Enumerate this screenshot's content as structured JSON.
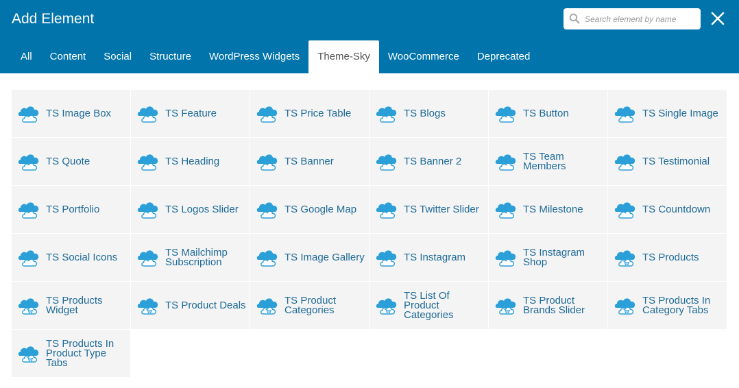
{
  "header": {
    "title": "Add Element",
    "search_placeholder": "Search element by name",
    "search_value": "",
    "background": "#0074ab"
  },
  "tabs": [
    {
      "label": "All",
      "active": false
    },
    {
      "label": "Content",
      "active": false
    },
    {
      "label": "Social",
      "active": false
    },
    {
      "label": "Structure",
      "active": false
    },
    {
      "label": "WordPress Widgets",
      "active": false
    },
    {
      "label": "Theme-Sky",
      "active": true
    },
    {
      "label": "WooCommerce",
      "active": false
    },
    {
      "label": "Deprecated",
      "active": false
    }
  ],
  "elements": [
    {
      "label": "TS Image Box",
      "icon": "cloud-icon"
    },
    {
      "label": "TS Feature",
      "icon": "cloud-icon"
    },
    {
      "label": "TS Price Table",
      "icon": "cloud-icon"
    },
    {
      "label": "TS Blogs",
      "icon": "cloud-icon"
    },
    {
      "label": "TS Button",
      "icon": "cloud-icon"
    },
    {
      "label": "TS Single Image",
      "icon": "cloud-icon"
    },
    {
      "label": "TS Quote",
      "icon": "cloud-icon"
    },
    {
      "label": "TS Heading",
      "icon": "cloud-icon"
    },
    {
      "label": "TS Banner",
      "icon": "cloud-icon"
    },
    {
      "label": "TS Banner 2",
      "icon": "cloud-icon"
    },
    {
      "label": "TS Team Members",
      "icon": "cloud-icon"
    },
    {
      "label": "TS Testimonial",
      "icon": "cloud-icon"
    },
    {
      "label": "TS Portfolio",
      "icon": "cloud-icon"
    },
    {
      "label": "TS Logos Slider",
      "icon": "cloud-icon"
    },
    {
      "label": "TS Google Map",
      "icon": "cloud-icon"
    },
    {
      "label": "TS Twitter Slider",
      "icon": "cloud-icon"
    },
    {
      "label": "TS Milestone",
      "icon": "cloud-icon"
    },
    {
      "label": "TS Countdown",
      "icon": "cloud-icon"
    },
    {
      "label": "TS Social Icons",
      "icon": "cloud-icon"
    },
    {
      "label": "TS Mailchimp Subscription",
      "icon": "cloud-icon"
    },
    {
      "label": "TS Image Gallery",
      "icon": "cloud-icon"
    },
    {
      "label": "TS Instagram",
      "icon": "cloud-icon"
    },
    {
      "label": "TS Instagram Shop",
      "icon": "cloud-icon"
    },
    {
      "label": "TS Products",
      "icon": "cloud-cart-icon"
    },
    {
      "label": "TS Products Widget",
      "icon": "cloud-cart-icon"
    },
    {
      "label": "TS Product Deals",
      "icon": "cloud-cart-icon"
    },
    {
      "label": "TS Product Categories",
      "icon": "cloud-cart-icon"
    },
    {
      "label": "TS List Of Product Categories",
      "icon": "cloud-cart-icon"
    },
    {
      "label": "TS Product Brands Slider",
      "icon": "cloud-cart-icon"
    },
    {
      "label": "TS Products In Category Tabs",
      "icon": "cloud-cart-icon"
    },
    {
      "label": "TS Products In Product Type Tabs",
      "icon": "cloud-cart-icon"
    }
  ]
}
